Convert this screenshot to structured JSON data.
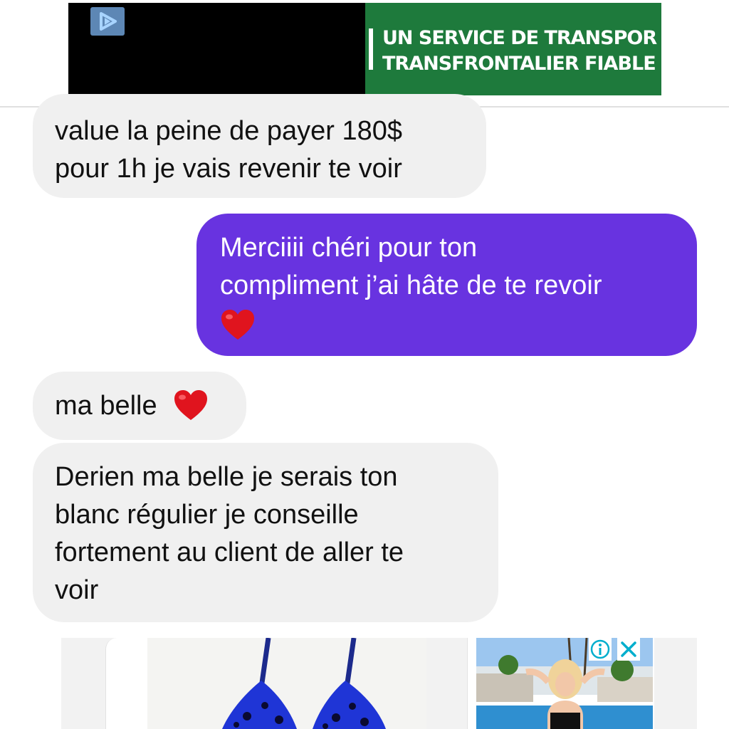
{
  "top_ad": {
    "line1": "UN SERVICE DE TRANSPOR",
    "line2": "TRANSFRONTALIER FIABLE",
    "left_bg_color": "#000000",
    "right_bg_color": "#1e7a3c",
    "logo_icon": "play-logo-icon"
  },
  "messages": [
    {
      "direction": "incoming",
      "lines": [
        "value la peine de payer 180$",
        "pour 1h je vais revenir te voir"
      ]
    },
    {
      "direction": "outgoing",
      "lines": [
        "Merciiii chéri pour ton",
        "compliment j’ai hâte de te revoir"
      ],
      "emoji": "heart-icon"
    },
    {
      "direction": "incoming",
      "lines": [
        "ma belle"
      ],
      "emoji": "heart-icon"
    },
    {
      "direction": "incoming",
      "lines": [
        "Derien ma belle je serais ton",
        "blanc régulier je conseille",
        "fortement au client de aller te",
        "voir"
      ]
    }
  ],
  "colors": {
    "outgoing_bubble": "#6833e0",
    "incoming_bubble": "#f0f0f0",
    "heart": "#e0141e"
  },
  "bottom_ads": {
    "product_icon": "bikini-product-image",
    "video_icon": "video-ad-thumbnail",
    "adchoices_icon": "adchoices-info-icon",
    "close_icon": "close-icon"
  }
}
